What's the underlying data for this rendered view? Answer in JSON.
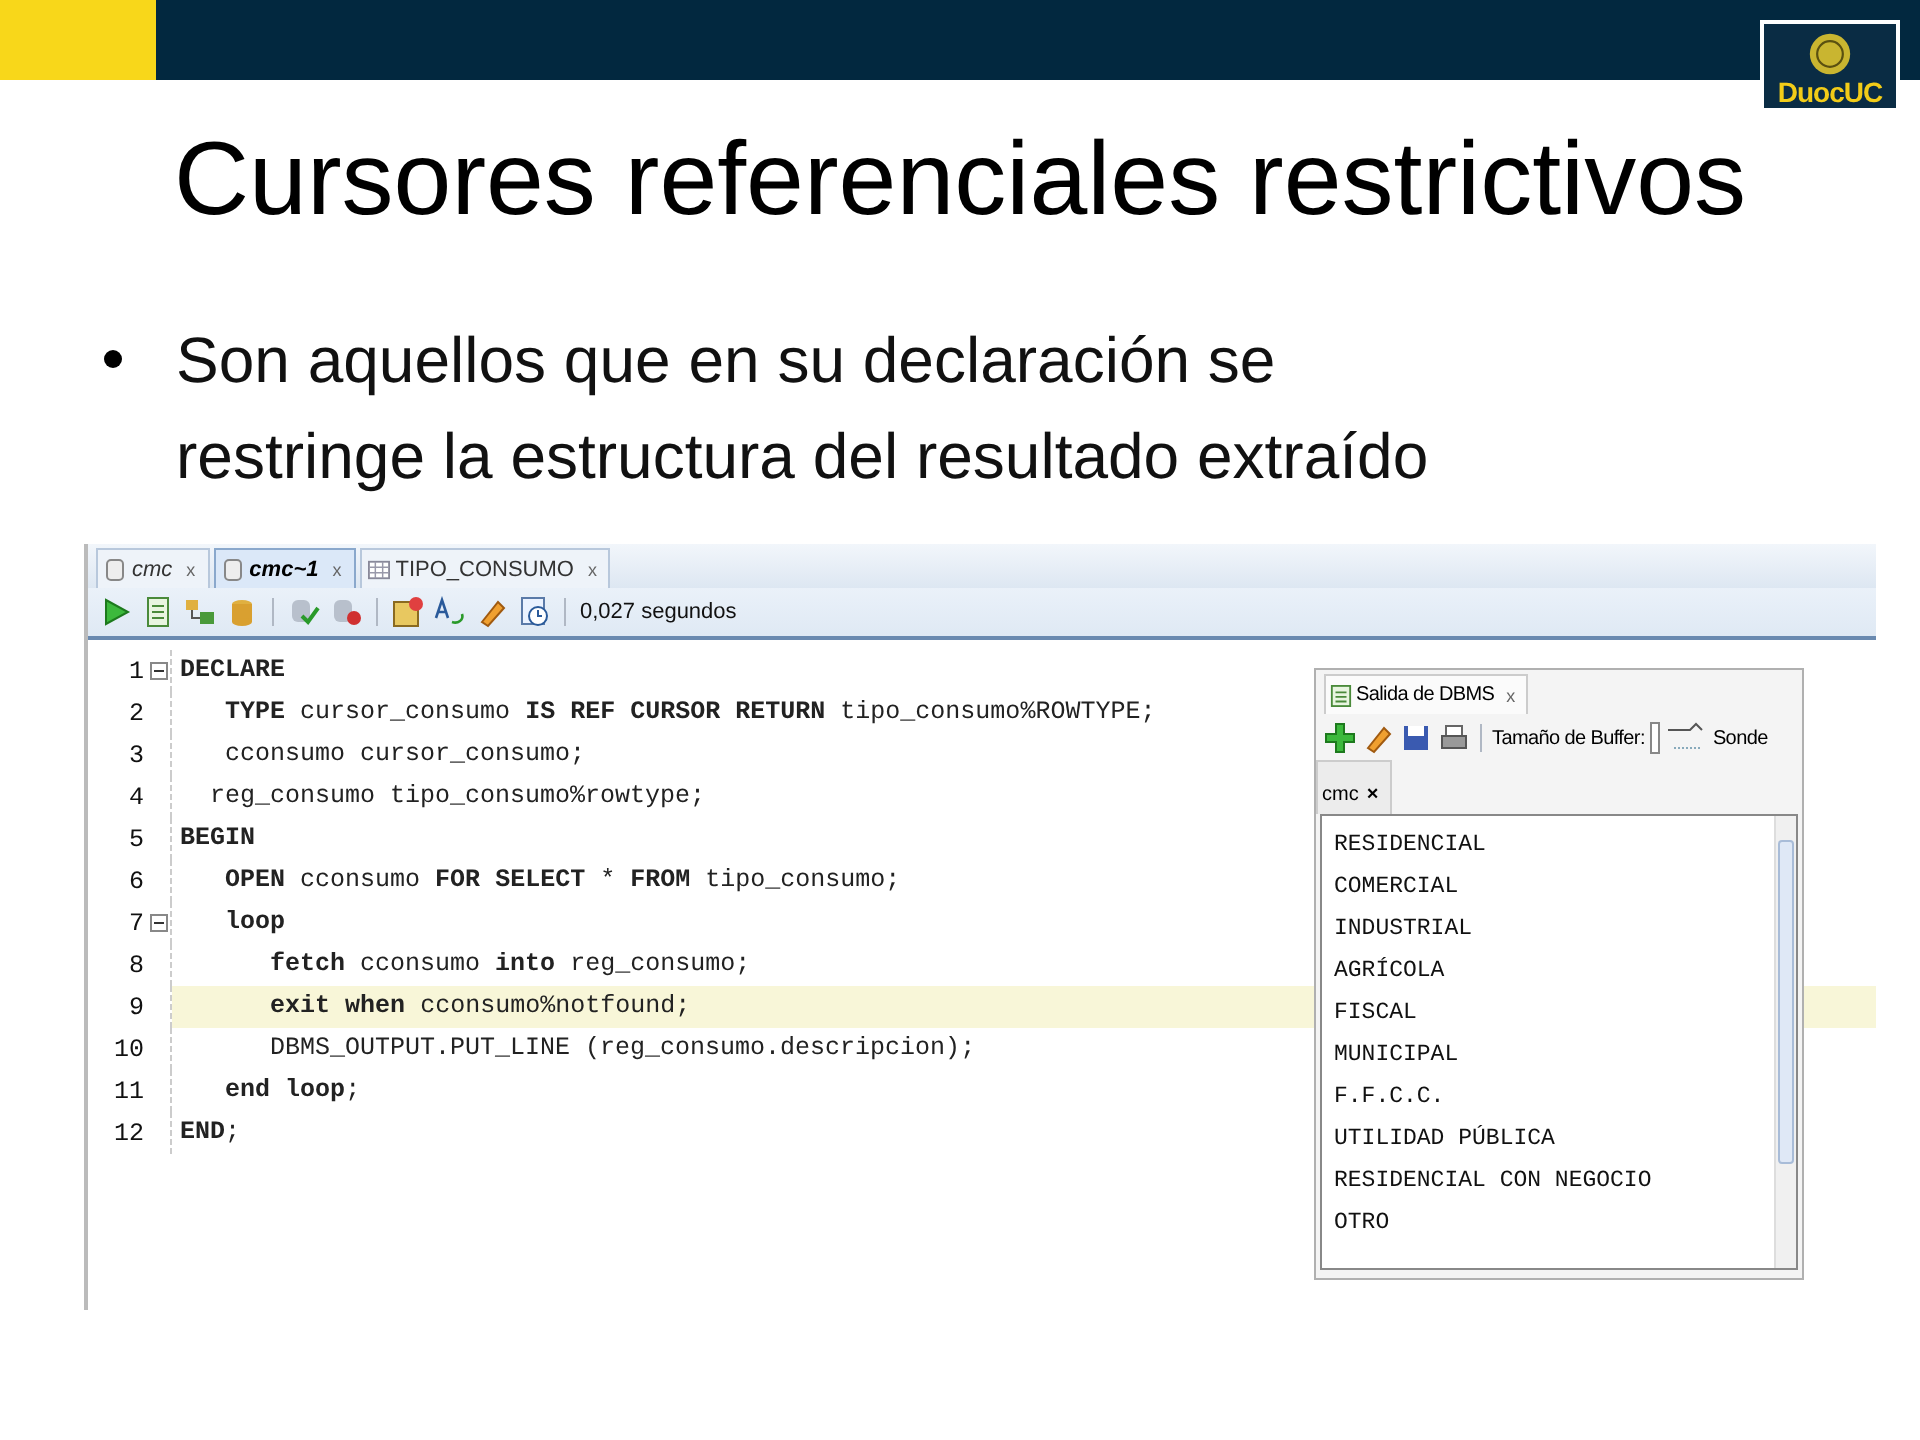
{
  "logo": {
    "text": "DuocUC"
  },
  "title": "Cursores referenciales restrictivos",
  "bullets": [
    "Son aquellos que en su declaración se restringe la estructura del resultado extraído"
  ],
  "editor": {
    "tabs": [
      {
        "label": "cmc",
        "kind": "script",
        "selected": false,
        "close": "x"
      },
      {
        "label": "cmc~1",
        "kind": "script",
        "selected": true,
        "close": "x"
      },
      {
        "label": "TIPO_CONSUMO",
        "kind": "table",
        "selected": false,
        "close": "x"
      }
    ],
    "elapsed": "0,027 segundos",
    "lines": [
      {
        "number": "1",
        "text": "**DECLARE**",
        "highlighted": false
      },
      {
        "number": "2",
        "text": "   **TYPE** cursor_consumo **IS** **REF** **CURSOR** **RETURN** tipo_consumo%ROWTYPE;",
        "highlighted": false
      },
      {
        "number": "3",
        "text": "   cconsumo cursor_consumo;",
        "highlighted": false
      },
      {
        "number": "4",
        "text": "  reg_consumo tipo_consumo%rowtype;",
        "highlighted": false
      },
      {
        "number": "5",
        "text": "**BEGIN**",
        "highlighted": false
      },
      {
        "number": "6",
        "text": "   **OPEN** cconsumo **FOR** **SELECT** * **FROM** tipo_consumo;",
        "highlighted": false
      },
      {
        "number": "7",
        "text": "   **loop**",
        "highlighted": false
      },
      {
        "number": "8",
        "text": "      **fetch** cconsumo **into** reg_consumo;",
        "highlighted": false
      },
      {
        "number": "9",
        "text": "      **exit** **when** cconsumo%notfound;",
        "highlighted": true
      },
      {
        "number": "10",
        "text": "      DBMS_OUTPUT.PUT_LINE (reg_consumo.descripcion);",
        "highlighted": false
      },
      {
        "number": "11",
        "text": "   **end** **loop**;",
        "highlighted": false
      },
      {
        "number": "12",
        "text": "**END**;",
        "highlighted": false
      }
    ]
  },
  "dbms_output": {
    "tab": "Salida de DBMS",
    "tab_close": "x",
    "buffer_label": "Tamaño de Buffer:",
    "cut_label": "Sonde",
    "connection_tab": "cmc",
    "connection_close": "×",
    "lines": [
      "RESIDENCIAL",
      "COMERCIAL",
      "INDUSTRIAL",
      "AGRÍCOLA",
      "FISCAL",
      "MUNICIPAL",
      "F.F.C.C.",
      "UTILIDAD PÚBLICA",
      "RESIDENCIAL CON NEGOCIO",
      "OTRO"
    ]
  }
}
